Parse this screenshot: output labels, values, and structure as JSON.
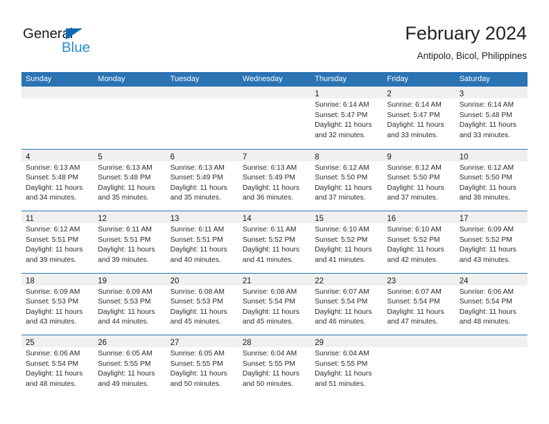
{
  "brand": {
    "name_part1": "General",
    "name_part2": "Blue",
    "triangle_icon": "triangle-icon",
    "color_dark": "#1a1a1a",
    "color_blue": "#2b8ad6"
  },
  "header": {
    "title": "February 2024",
    "subtitle": "Antipolo, Bicol, Philippines"
  },
  "theme": {
    "header_blue": "#2b73b3",
    "day_strip_gray": "#f0f0f0",
    "text_color": "#2a2a2a"
  },
  "weekdays": [
    "Sunday",
    "Monday",
    "Tuesday",
    "Wednesday",
    "Thursday",
    "Friday",
    "Saturday"
  ],
  "weeks": [
    [
      {
        "day": "",
        "lines": []
      },
      {
        "day": "",
        "lines": []
      },
      {
        "day": "",
        "lines": []
      },
      {
        "day": "",
        "lines": []
      },
      {
        "day": "1",
        "lines": [
          "Sunrise: 6:14 AM",
          "Sunset: 5:47 PM",
          "Daylight: 11 hours",
          "and 32 minutes."
        ]
      },
      {
        "day": "2",
        "lines": [
          "Sunrise: 6:14 AM",
          "Sunset: 5:47 PM",
          "Daylight: 11 hours",
          "and 33 minutes."
        ]
      },
      {
        "day": "3",
        "lines": [
          "Sunrise: 6:14 AM",
          "Sunset: 5:48 PM",
          "Daylight: 11 hours",
          "and 33 minutes."
        ]
      }
    ],
    [
      {
        "day": "4",
        "lines": [
          "Sunrise: 6:13 AM",
          "Sunset: 5:48 PM",
          "Daylight: 11 hours",
          "and 34 minutes."
        ]
      },
      {
        "day": "5",
        "lines": [
          "Sunrise: 6:13 AM",
          "Sunset: 5:48 PM",
          "Daylight: 11 hours",
          "and 35 minutes."
        ]
      },
      {
        "day": "6",
        "lines": [
          "Sunrise: 6:13 AM",
          "Sunset: 5:49 PM",
          "Daylight: 11 hours",
          "and 35 minutes."
        ]
      },
      {
        "day": "7",
        "lines": [
          "Sunrise: 6:13 AM",
          "Sunset: 5:49 PM",
          "Daylight: 11 hours",
          "and 36 minutes."
        ]
      },
      {
        "day": "8",
        "lines": [
          "Sunrise: 6:12 AM",
          "Sunset: 5:50 PM",
          "Daylight: 11 hours",
          "and 37 minutes."
        ]
      },
      {
        "day": "9",
        "lines": [
          "Sunrise: 6:12 AM",
          "Sunset: 5:50 PM",
          "Daylight: 11 hours",
          "and 37 minutes."
        ]
      },
      {
        "day": "10",
        "lines": [
          "Sunrise: 6:12 AM",
          "Sunset: 5:50 PM",
          "Daylight: 11 hours",
          "and 38 minutes."
        ]
      }
    ],
    [
      {
        "day": "11",
        "lines": [
          "Sunrise: 6:12 AM",
          "Sunset: 5:51 PM",
          "Daylight: 11 hours",
          "and 39 minutes."
        ]
      },
      {
        "day": "12",
        "lines": [
          "Sunrise: 6:11 AM",
          "Sunset: 5:51 PM",
          "Daylight: 11 hours",
          "and 39 minutes."
        ]
      },
      {
        "day": "13",
        "lines": [
          "Sunrise: 6:11 AM",
          "Sunset: 5:51 PM",
          "Daylight: 11 hours",
          "and 40 minutes."
        ]
      },
      {
        "day": "14",
        "lines": [
          "Sunrise: 6:11 AM",
          "Sunset: 5:52 PM",
          "Daylight: 11 hours",
          "and 41 minutes."
        ]
      },
      {
        "day": "15",
        "lines": [
          "Sunrise: 6:10 AM",
          "Sunset: 5:52 PM",
          "Daylight: 11 hours",
          "and 41 minutes."
        ]
      },
      {
        "day": "16",
        "lines": [
          "Sunrise: 6:10 AM",
          "Sunset: 5:52 PM",
          "Daylight: 11 hours",
          "and 42 minutes."
        ]
      },
      {
        "day": "17",
        "lines": [
          "Sunrise: 6:09 AM",
          "Sunset: 5:52 PM",
          "Daylight: 11 hours",
          "and 43 minutes."
        ]
      }
    ],
    [
      {
        "day": "18",
        "lines": [
          "Sunrise: 6:09 AM",
          "Sunset: 5:53 PM",
          "Daylight: 11 hours",
          "and 43 minutes."
        ]
      },
      {
        "day": "19",
        "lines": [
          "Sunrise: 6:09 AM",
          "Sunset: 5:53 PM",
          "Daylight: 11 hours",
          "and 44 minutes."
        ]
      },
      {
        "day": "20",
        "lines": [
          "Sunrise: 6:08 AM",
          "Sunset: 5:53 PM",
          "Daylight: 11 hours",
          "and 45 minutes."
        ]
      },
      {
        "day": "21",
        "lines": [
          "Sunrise: 6:08 AM",
          "Sunset: 5:54 PM",
          "Daylight: 11 hours",
          "and 45 minutes."
        ]
      },
      {
        "day": "22",
        "lines": [
          "Sunrise: 6:07 AM",
          "Sunset: 5:54 PM",
          "Daylight: 11 hours",
          "and 46 minutes."
        ]
      },
      {
        "day": "23",
        "lines": [
          "Sunrise: 6:07 AM",
          "Sunset: 5:54 PM",
          "Daylight: 11 hours",
          "and 47 minutes."
        ]
      },
      {
        "day": "24",
        "lines": [
          "Sunrise: 6:06 AM",
          "Sunset: 5:54 PM",
          "Daylight: 11 hours",
          "and 48 minutes."
        ]
      }
    ],
    [
      {
        "day": "25",
        "lines": [
          "Sunrise: 6:06 AM",
          "Sunset: 5:54 PM",
          "Daylight: 11 hours",
          "and 48 minutes."
        ]
      },
      {
        "day": "26",
        "lines": [
          "Sunrise: 6:05 AM",
          "Sunset: 5:55 PM",
          "Daylight: 11 hours",
          "and 49 minutes."
        ]
      },
      {
        "day": "27",
        "lines": [
          "Sunrise: 6:05 AM",
          "Sunset: 5:55 PM",
          "Daylight: 11 hours",
          "and 50 minutes."
        ]
      },
      {
        "day": "28",
        "lines": [
          "Sunrise: 6:04 AM",
          "Sunset: 5:55 PM",
          "Daylight: 11 hours",
          "and 50 minutes."
        ]
      },
      {
        "day": "29",
        "lines": [
          "Sunrise: 6:04 AM",
          "Sunset: 5:55 PM",
          "Daylight: 11 hours",
          "and 51 minutes."
        ]
      },
      {
        "day": "",
        "lines": []
      },
      {
        "day": "",
        "lines": []
      }
    ]
  ]
}
